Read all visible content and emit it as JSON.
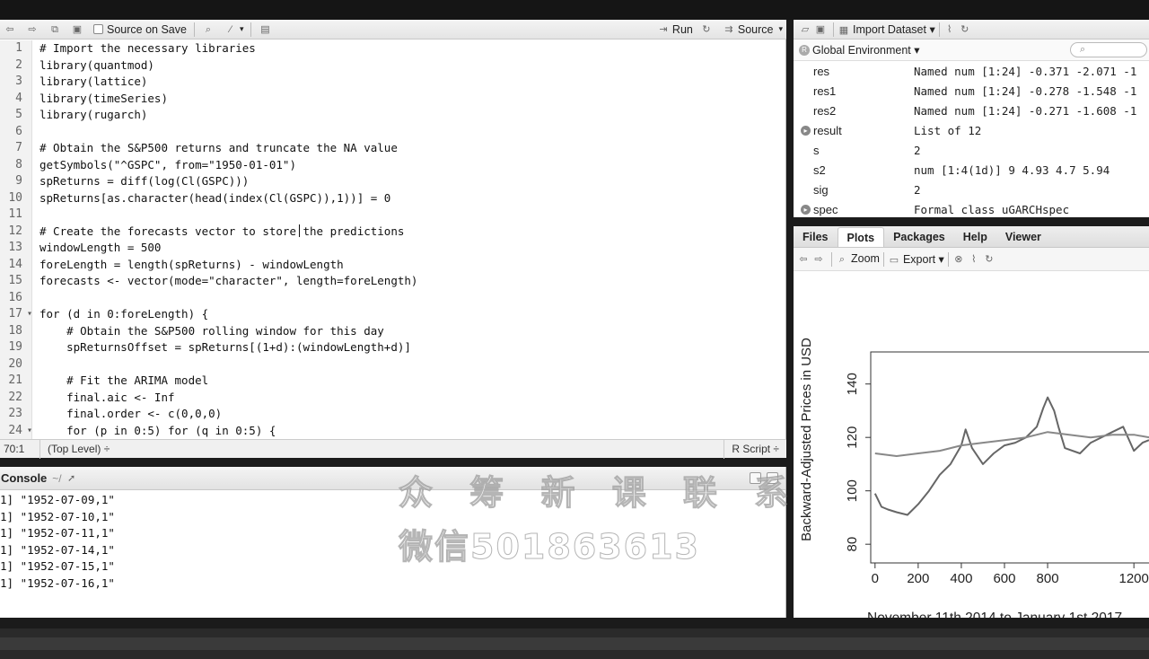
{
  "editor": {
    "toolbar": {
      "source_on_save": "Source on Save",
      "run": "Run",
      "source": "Source"
    },
    "lines": [
      "# Import the necessary libraries",
      "library(quantmod)",
      "library(lattice)",
      "library(timeSeries)",
      "library(rugarch)",
      "",
      "# Obtain the S&P500 returns and truncate the NA value",
      "getSymbols(\"^GSPC\", from=\"1950-01-01\")",
      "spReturns = diff(log(Cl(GSPC)))",
      "spReturns[as.character(head(index(Cl(GSPC)),1))] = 0",
      "",
      "# Create the forecasts vector to store the predictions",
      "windowLength = 500",
      "foreLength = length(spReturns) - windowLength",
      "forecasts <- vector(mode=\"character\", length=foreLength)",
      "",
      "for (d in 0:foreLength) {",
      "    # Obtain the S&P500 rolling window for this day",
      "    spReturnsOffset = spReturns[(1+d):(windowLength+d)]",
      "",
      "    # Fit the ARIMA model",
      "    final.aic <- Inf",
      "    final.order <- c(0,0,0)",
      "    for (p in 0:5) for (q in 0:5) {"
    ],
    "line_numbers": [
      "1",
      "2",
      "3",
      "4",
      "5",
      "6",
      "7",
      "8",
      "9",
      "10",
      "11",
      "12",
      "13",
      "14",
      "15",
      "16",
      "17",
      "18",
      "19",
      "20",
      "21",
      "22",
      "23",
      "24"
    ],
    "status": {
      "position": "70:1",
      "scope": "(Top Level) ÷",
      "filetype": "R Script ÷"
    }
  },
  "console": {
    "title": "Console",
    "path": "~/",
    "lines": [
      "1] \"1952-07-09,1\"",
      "1] \"1952-07-10,1\"",
      "1] \"1952-07-11,1\"",
      "1] \"1952-07-14,1\"",
      "1] \"1952-07-15,1\"",
      "1] \"1952-07-16,1\""
    ]
  },
  "watermark": {
    "line1": "众 筹 新 课 联 系",
    "line2": "微信501863613"
  },
  "environment": {
    "toolbar": {
      "import": "Import Dataset ▾"
    },
    "scope": "Global Environment ▾",
    "rows": [
      {
        "name": "res",
        "value": "Named num [1:24] -0.371 -2.071 -1",
        "bullet": ""
      },
      {
        "name": "res1",
        "value": "Named num [1:24] -0.278 -1.548 -1",
        "bullet": ""
      },
      {
        "name": "res2",
        "value": "Named num [1:24] -0.271 -1.608 -1",
        "bullet": ""
      },
      {
        "name": "result",
        "value": "List of 12",
        "bullet": "▸"
      },
      {
        "name": "s",
        "value": "2",
        "bullet": ""
      },
      {
        "name": "s2",
        "value": "num [1:4(1d)] 9 4.93 4.7 5.94",
        "bullet": ""
      },
      {
        "name": "sig",
        "value": "2",
        "bullet": ""
      },
      {
        "name": "spec",
        "value": "Formal class uGARCHspec",
        "bullet": "▸"
      }
    ]
  },
  "plots": {
    "tabs": [
      "Files",
      "Plots",
      "Packages",
      "Help",
      "Viewer"
    ],
    "active_tab": "Plots",
    "toolbar": {
      "zoom": "Zoom",
      "export": "Export ▾"
    }
  },
  "chart_data": {
    "type": "line",
    "ylabel": "Backward-Adjusted Prices in USD",
    "xlabel": "November 11th 2014 to January 1st 2017",
    "x_ticks": [
      0,
      200,
      400,
      600,
      800,
      1200
    ],
    "y_ticks": [
      80,
      100,
      120,
      140
    ],
    "xlim": [
      -20,
      1270
    ],
    "ylim": [
      73,
      152
    ],
    "series": [
      {
        "x": [
          0,
          30,
          60,
          100,
          150,
          200,
          250,
          300,
          350,
          400,
          420,
          450,
          500,
          550,
          600,
          650,
          700,
          750,
          780,
          800,
          830,
          850,
          880,
          950,
          1000,
          1100,
          1150,
          1200,
          1240,
          1270
        ],
        "y": [
          99,
          94,
          93,
          92,
          91,
          95,
          100,
          106,
          110,
          117,
          123,
          116,
          110,
          114,
          117,
          118,
          120,
          124,
          131,
          135,
          130,
          124,
          116,
          114,
          118,
          122,
          124,
          115,
          118,
          119
        ]
      },
      {
        "x": [
          0,
          100,
          200,
          300,
          400,
          500,
          600,
          700,
          800,
          900,
          1000,
          1100,
          1200,
          1270
        ],
        "y": [
          114,
          113,
          114,
          115,
          117,
          118,
          119,
          120,
          122,
          121,
          120,
          121,
          121,
          120
        ]
      }
    ]
  }
}
